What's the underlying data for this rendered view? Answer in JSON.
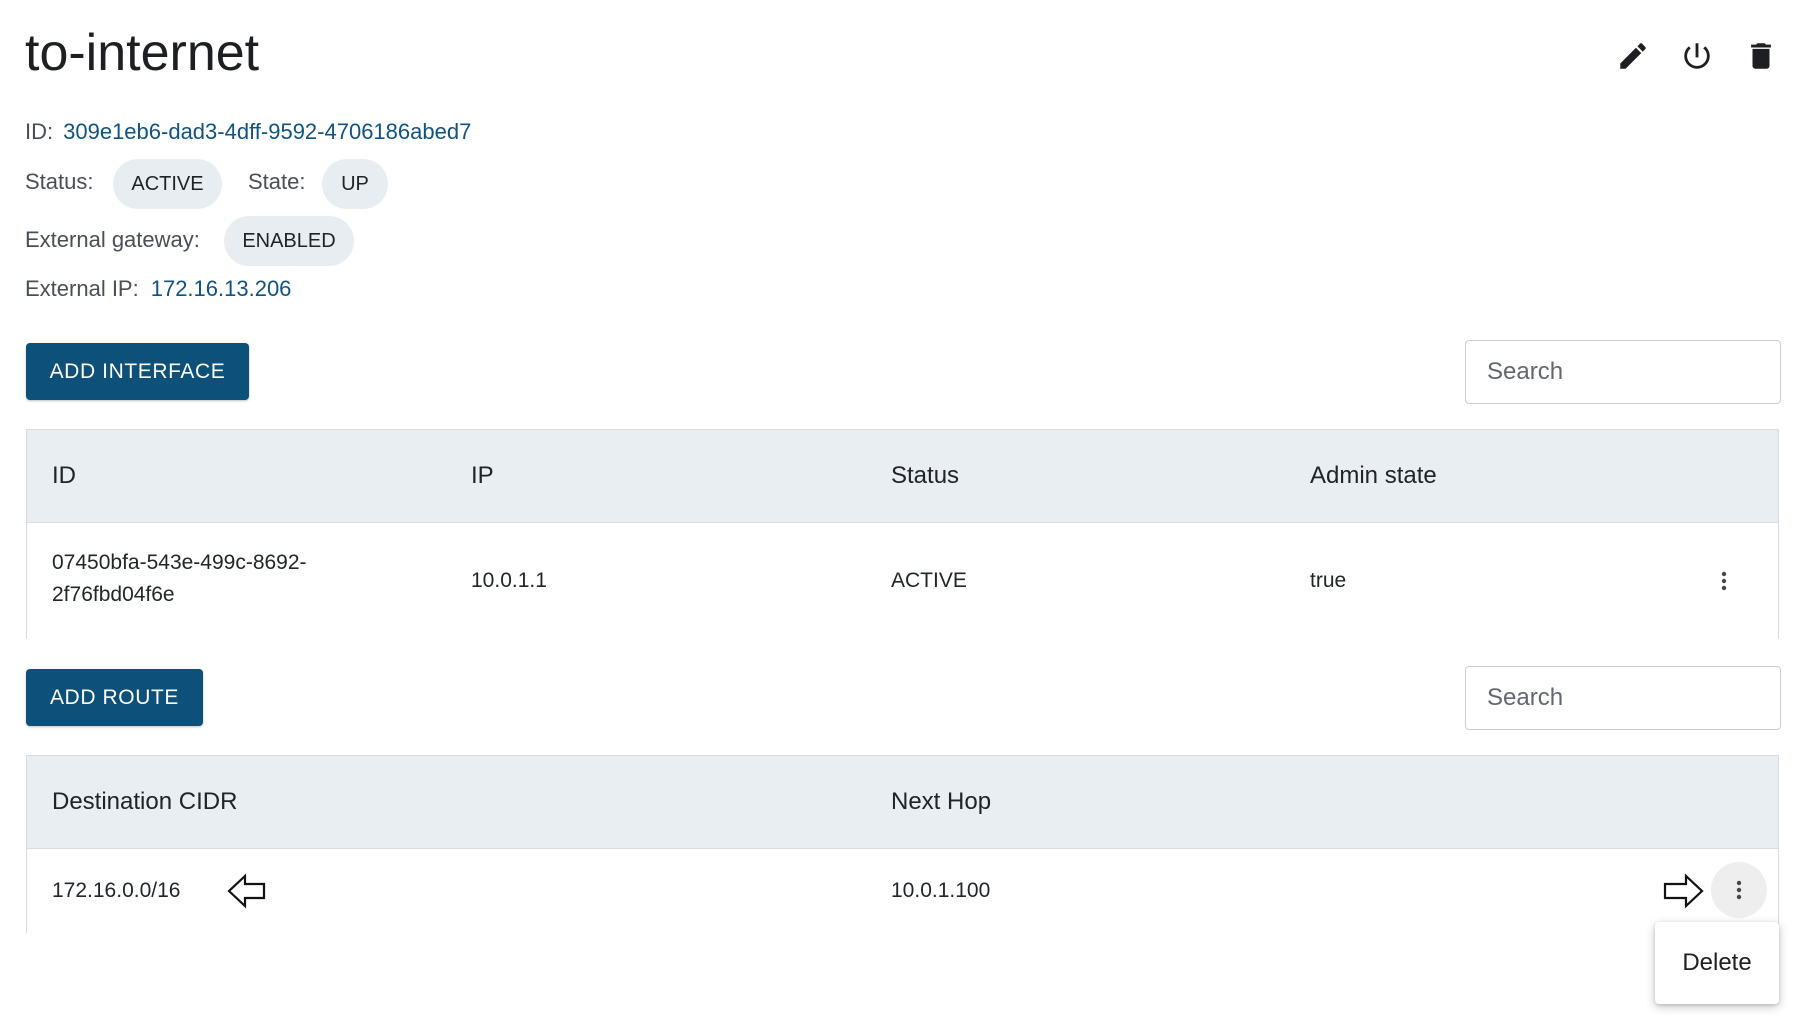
{
  "header": {
    "title": "to-internet",
    "icons": [
      "pencil-icon",
      "power-icon",
      "trash-icon"
    ]
  },
  "details": {
    "id_label": "ID:",
    "id_value": "309e1eb6-dad3-4dff-9592-4706186abed7",
    "status_label": "Status:",
    "status_value": "ACTIVE",
    "state_label": "State:",
    "state_value": "UP",
    "external_gateway_label": "External gateway:",
    "external_gateway_value": "ENABLED",
    "external_ip_label": "External IP:",
    "external_ip_value": "172.16.13.206"
  },
  "interfaces": {
    "add_button": "ADD INTERFACE",
    "search_placeholder": "Search",
    "columns": [
      "ID",
      "IP",
      "Status",
      "Admin state"
    ],
    "rows": [
      {
        "id_line1": "07450bfa-543e-499c-8692-",
        "id_line2": "2f76fbd04f6e",
        "ip": "10.0.1.1",
        "status": "ACTIVE",
        "admin_state": "true"
      }
    ]
  },
  "routes": {
    "add_button": "ADD ROUTE",
    "search_placeholder": "Search",
    "columns": [
      "Destination CIDR",
      "Next Hop"
    ],
    "rows": [
      {
        "destination": "172.16.0.0/16",
        "next_hop": "10.0.1.100"
      }
    ]
  },
  "context_menu": {
    "items": [
      "Delete"
    ]
  },
  "colors": {
    "primary": "#0d5079",
    "link": "#0f5384",
    "chip_bg": "#e8edf2",
    "table_header_bg": "#e9eef3"
  }
}
